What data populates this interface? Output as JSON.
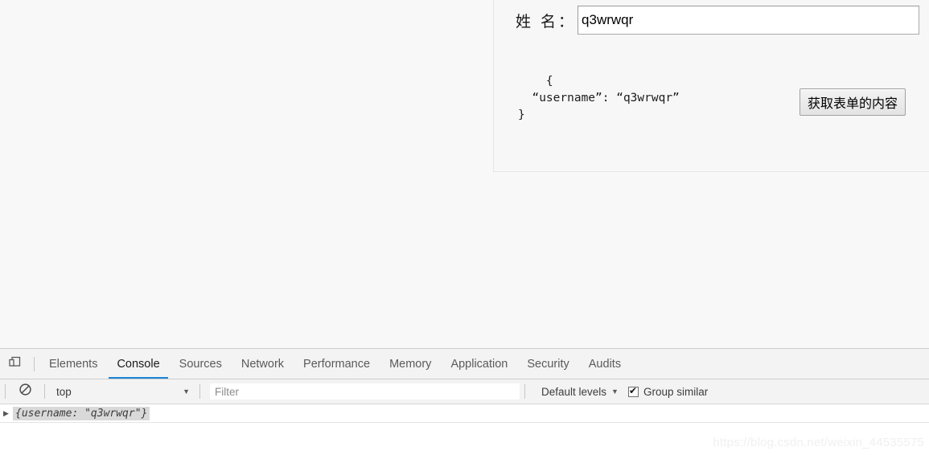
{
  "page": {
    "background_color": "#f8f8f8",
    "form": {
      "name_label": "姓 名：",
      "name_value": "q3wrwqr",
      "name_placeholder": "",
      "json_output": "    {\n  “username”: “q3wrwqr”\n}",
      "submit_label": "获取表单的内容"
    }
  },
  "devtools": {
    "device_toolbar_icon": "device-toolbar-icon",
    "clear_console_icon": "clear-console-icon",
    "tabs": [
      {
        "label": "Elements",
        "active": false
      },
      {
        "label": "Console",
        "active": true
      },
      {
        "label": "Sources",
        "active": false
      },
      {
        "label": "Network",
        "active": false
      },
      {
        "label": "Performance",
        "active": false
      },
      {
        "label": "Memory",
        "active": false
      },
      {
        "label": "Application",
        "active": false
      },
      {
        "label": "Security",
        "active": false
      },
      {
        "label": "Audits",
        "active": false
      }
    ],
    "active_tab_underline_color": "#1a86d8",
    "toolbar": {
      "context_value": "top",
      "context_caret": "▼",
      "filter_placeholder": "Filter",
      "filter_value": "",
      "levels_label": "Default levels",
      "levels_caret": "▼",
      "group_similar_label": "Group similar",
      "group_similar_checked": true
    },
    "console_rows": [
      {
        "disclosure": "▶",
        "text": "{username: \"q3wrwqr\"}"
      }
    ]
  },
  "watermark": {
    "text": "https://blog.csdn.net/weixin_44535575"
  }
}
